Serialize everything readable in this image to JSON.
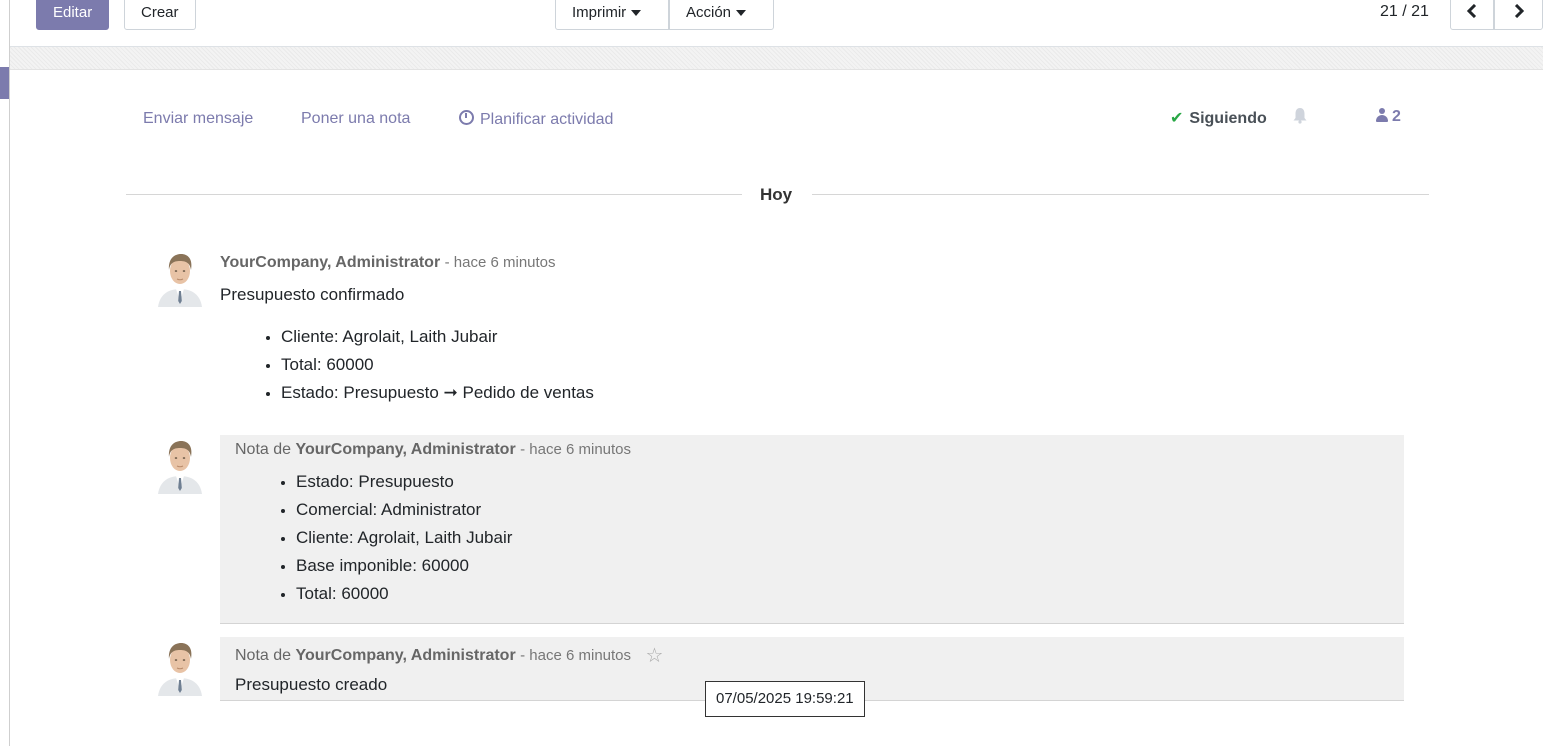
{
  "control_panel": {
    "edit_label": "Editar",
    "create_label": "Crear",
    "print_label": "Imprimir",
    "action_label": "Acción",
    "pager_value": "21 / 21",
    "pager_prev_icon": "chevron-left-icon",
    "pager_next_icon": "chevron-right-icon"
  },
  "chatter": {
    "send_message": "Enviar mensaje",
    "log_note": "Poner una nota",
    "schedule_activity": "Planificar actividad",
    "following": "Siguiendo",
    "followers_count": "2"
  },
  "separator": "Hoy",
  "messages": [
    {
      "author": "YourCompany, Administrator",
      "date": "- hace 6 minutos",
      "body": "Presupuesto confirmado",
      "tracking": [
        "Cliente: Agrolait, Laith Jubair",
        "Total: 60000",
        "Estado: Presupuesto ➞ Pedido de ventas"
      ]
    },
    {
      "prefix": "Nota de",
      "author": "YourCompany, Administrator",
      "date": "- hace 6 minutos",
      "tracking": [
        "Estado: Presupuesto",
        "Comercial: Administrator",
        "Cliente: Agrolait, Laith Jubair",
        "Base imponible: 60000",
        "Total: 60000"
      ]
    },
    {
      "prefix": "Nota de",
      "author": "YourCompany, Administrator",
      "date": "- hace 6 minutos",
      "body": "Presupuesto creado"
    }
  ],
  "tooltip": "07/05/2025 19:59:21",
  "colors": {
    "brand": "#7c7bad",
    "check": "#28a745",
    "note_bg": "#f0f0f0"
  }
}
